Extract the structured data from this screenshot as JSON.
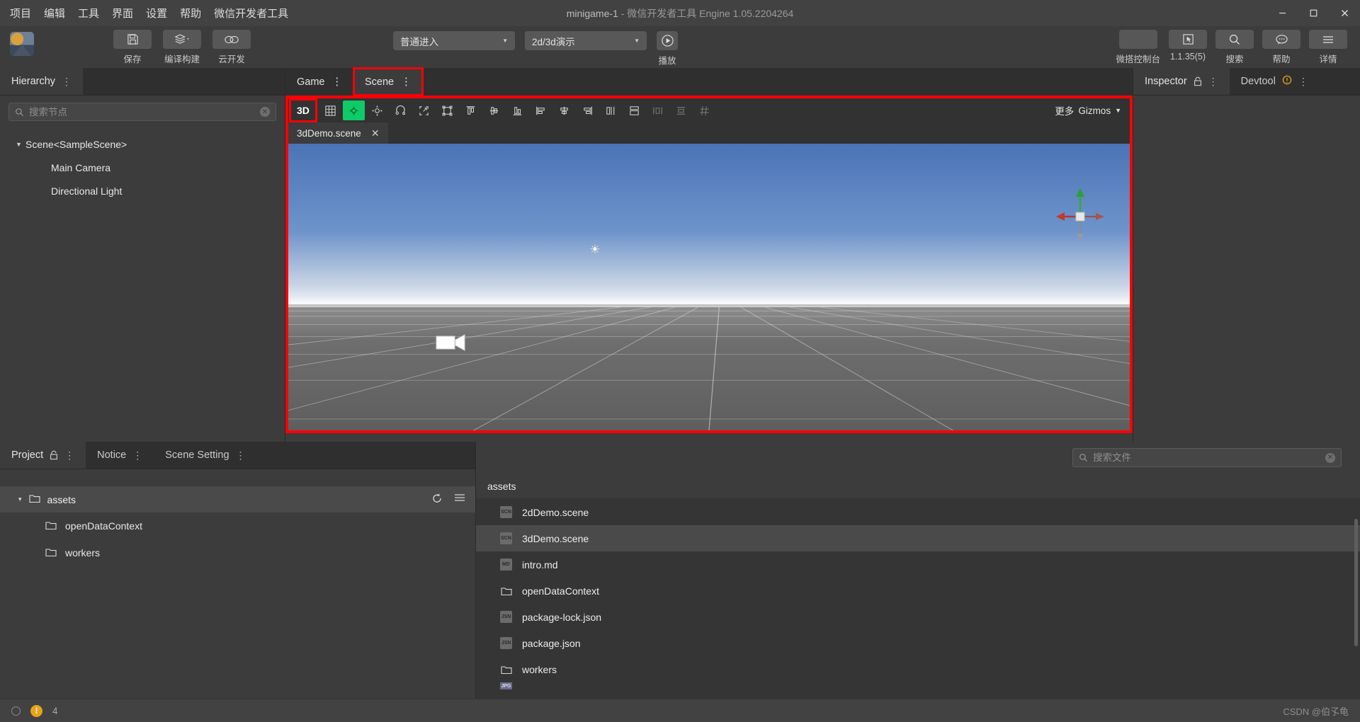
{
  "titlebar": {
    "menu": [
      "项目",
      "编辑",
      "工具",
      "界面",
      "设置",
      "帮助",
      "微信开发者工具"
    ],
    "title_project": "minigame-1",
    "title_dash": "-",
    "title_app": "微信开发者工具 Engine 1.05.2204264",
    "minimize": "—",
    "maximize": "▢",
    "close": "✕"
  },
  "toolbar": {
    "left_buttons": [
      {
        "label": "保存",
        "icon": "save-icon"
      },
      {
        "label": "编译构建",
        "icon": "layers-icon"
      },
      {
        "label": "云开发",
        "icon": "cloud-icon"
      }
    ],
    "mode_select": "普通进入",
    "scene_select": "2d/3d演示",
    "play_label": "播放",
    "right_buttons": [
      {
        "label": "微搭控制台",
        "icon": "blank-icon"
      },
      {
        "label": "1.1.35(5)",
        "icon": "cursor-box-icon"
      },
      {
        "label": "搜索",
        "icon": "search-icon"
      },
      {
        "label": "帮助",
        "icon": "chat-icon"
      },
      {
        "label": "详情",
        "icon": "hamburger-icon"
      }
    ]
  },
  "hierarchy": {
    "tab_label": "Hierarchy",
    "menu_dots": "⋮",
    "search_placeholder": "搜索节点",
    "search_value": "",
    "tree": [
      {
        "label": "Scene<SampleScene>",
        "depth": 0,
        "expanded": true
      },
      {
        "label": "Main Camera",
        "depth": 1
      },
      {
        "label": "Directional Light",
        "depth": 1
      }
    ]
  },
  "scene_panel": {
    "tabs": [
      {
        "label": "Game",
        "active": false,
        "highlighted": false
      },
      {
        "label": "Scene",
        "active": true,
        "highlighted": true
      }
    ],
    "menu_dots": "⋮",
    "toolbar": {
      "mode_3d": "3D",
      "more_label": "更多",
      "gizmos_label": "Gizmos",
      "caret": "▾",
      "tools": [
        "grid-icon",
        "move-tool-icon",
        "scale-tool-icon",
        "rotate-tool-icon",
        "rect-tool-icon",
        "transform-tool-icon",
        "align-top-icon",
        "align-vcenter-icon",
        "align-bottom-icon",
        "align-left-icon",
        "align-hcenter-icon",
        "align-right-icon",
        "distribute-h-icon",
        "distribute-v-icon",
        "space-h-icon",
        "space-v-icon",
        "snap-icon"
      ]
    },
    "file_tab": {
      "label": "3dDemo.scene",
      "close": "✕"
    }
  },
  "inspector": {
    "tab_label": "Inspector",
    "lock_icon": "lock-icon",
    "menu_dots": "⋮"
  },
  "devtool": {
    "tab_label": "Devtool",
    "warn_icon": "warning-icon",
    "menu_dots": "⋮"
  },
  "project_panel": {
    "tabs": [
      {
        "label": "Project",
        "active": true,
        "has_lock": true
      },
      {
        "label": "Notice",
        "active": false,
        "has_lock": false
      },
      {
        "label": "Scene Setting",
        "active": false,
        "has_lock": false
      }
    ],
    "menu_dots": "⋮",
    "root": {
      "label": "assets",
      "expanded": true,
      "triangle": "▾"
    },
    "header_actions": [
      "refresh-icon",
      "menu-icon"
    ],
    "folders": [
      {
        "label": "openDataContext",
        "icon": "folder-icon"
      },
      {
        "label": "workers",
        "icon": "folder-icon"
      }
    ]
  },
  "file_browser": {
    "search_placeholder": "搜索文件",
    "search_value": "",
    "breadcrumb": "assets",
    "files": [
      {
        "name": "2dDemo.scene",
        "type": "SCN",
        "selected": false
      },
      {
        "name": "3dDemo.scene",
        "type": "SCN",
        "selected": true
      },
      {
        "name": "intro.md",
        "type": "MD",
        "selected": false
      },
      {
        "name": "openDataContext",
        "type": "folder",
        "selected": false
      },
      {
        "name": "package-lock.json",
        "type": "JSN",
        "selected": false
      },
      {
        "name": "package.json",
        "type": "JSN",
        "selected": false
      },
      {
        "name": "workers",
        "type": "folder",
        "selected": false
      }
    ]
  },
  "statusbar": {
    "warn_count": "4",
    "warn_icon": "warning-icon",
    "status_circle": "status-circle-icon",
    "watermark": "CSDN @伯孓龟"
  },
  "colors": {
    "accent_red": "#fb0007",
    "accent_green": "#0ecb6a",
    "warn_orange": "#e8a317",
    "bg_dark": "#3c3c3c",
    "bg_darker": "#2f2f2f",
    "sky_blue": "#5b82bf"
  }
}
